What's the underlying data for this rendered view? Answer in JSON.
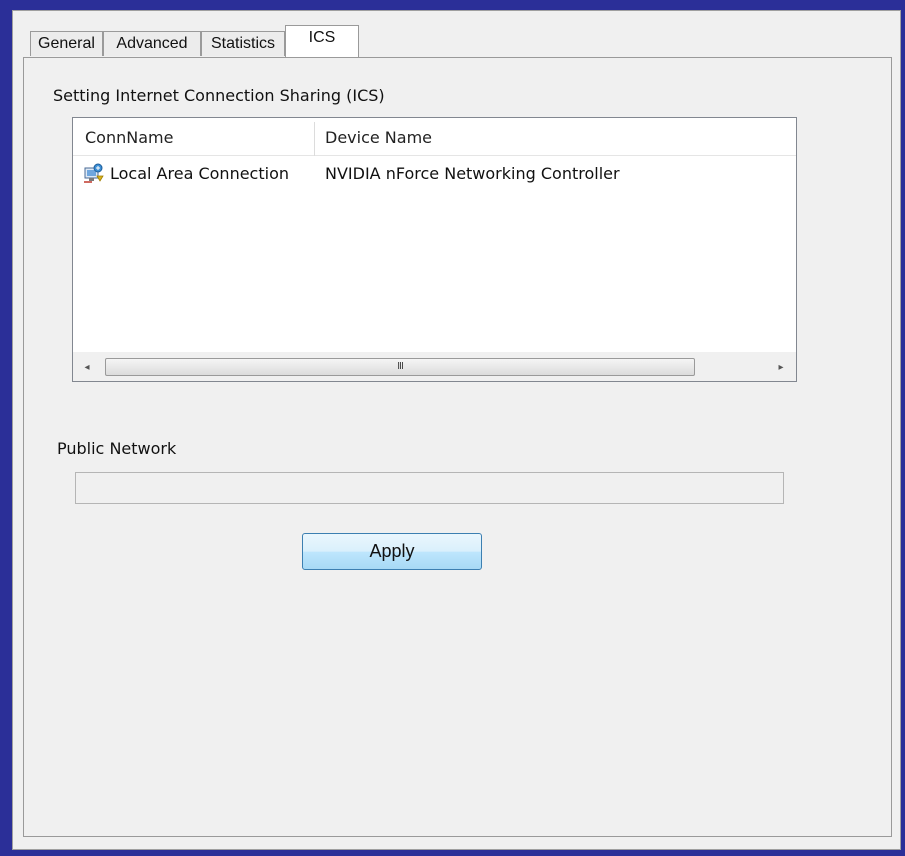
{
  "tabs": [
    {
      "label": "General"
    },
    {
      "label": "Advanced"
    },
    {
      "label": "Statistics"
    },
    {
      "label": "ICS",
      "active": true
    }
  ],
  "ics": {
    "section_title": "Setting Internet Connection Sharing (ICS)",
    "columns": [
      "ConnName",
      "Device Name"
    ],
    "rows": [
      {
        "conn_name": "Local Area Connection",
        "device_name": "NVIDIA nForce Networking Controller",
        "icon": "network-connection-icon"
      }
    ],
    "scrollbar": {
      "left_arrow": "◂",
      "right_arrow": "▸",
      "grip": "III"
    },
    "public_network_label": "Public Network",
    "public_network_value": "",
    "apply_label": "Apply"
  },
  "colors": {
    "frame": "#2b2f98",
    "accent": "#3c7fb1"
  }
}
